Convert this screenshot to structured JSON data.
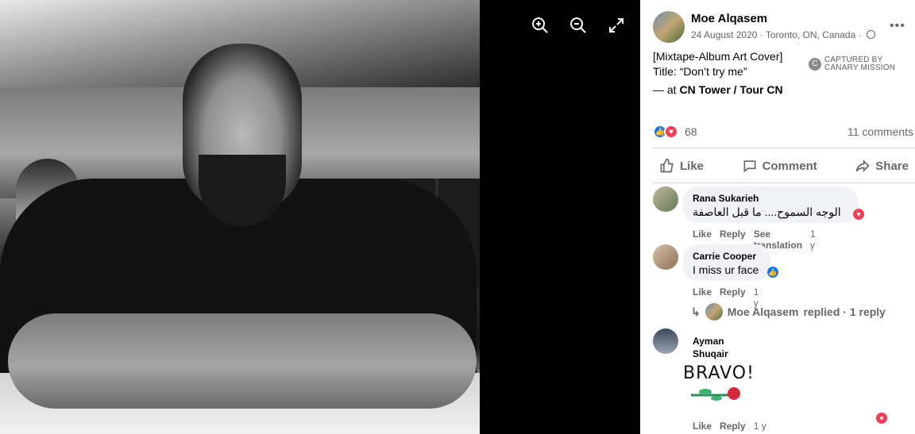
{
  "viewer": {
    "controls": [
      {
        "name": "zoom-in-icon"
      },
      {
        "name": "zoom-out-icon"
      },
      {
        "name": "fullscreen-icon"
      }
    ]
  },
  "post": {
    "author": "Moe Alqasem",
    "meta": "24 August 2020 · Toronto, ON, Canada ·",
    "caption_line1": "[Mixtape-Album Art Cover]",
    "caption_line2": "Title: “Don’t try me”",
    "checkin_prefix": "— at ",
    "checkin_place": "CN Tower / Tour CN",
    "reaction_count": "68",
    "comments_count": "11 comments",
    "watermark": {
      "line1": "CAPTURED BY",
      "line2": "CANARY MISSION"
    }
  },
  "actions": {
    "like": "Like",
    "comment": "Comment",
    "share": "Share"
  },
  "comments": [
    {
      "name": "Rana Sukarieh",
      "text": "الوجه السموح.... ما قبل العاصفة",
      "actions": [
        "Like",
        "Reply",
        "See translation"
      ],
      "time": "1 y"
    },
    {
      "name": "Carrie Cooper",
      "text": "I miss ur face",
      "actions": [
        "Like",
        "Reply"
      ],
      "time": "1 y"
    },
    {
      "name": "Ayman Shuqair",
      "sticker_text": "BRAVO!",
      "actions": [
        "Like",
        "Reply"
      ],
      "time": "1 y"
    }
  ],
  "reply_summary": {
    "author": "Moe Alqasem",
    "text": "replied · 1 reply"
  },
  "colors": {
    "accent": "#1877f2",
    "love": "#f33e58",
    "muted": "#65676b"
  }
}
